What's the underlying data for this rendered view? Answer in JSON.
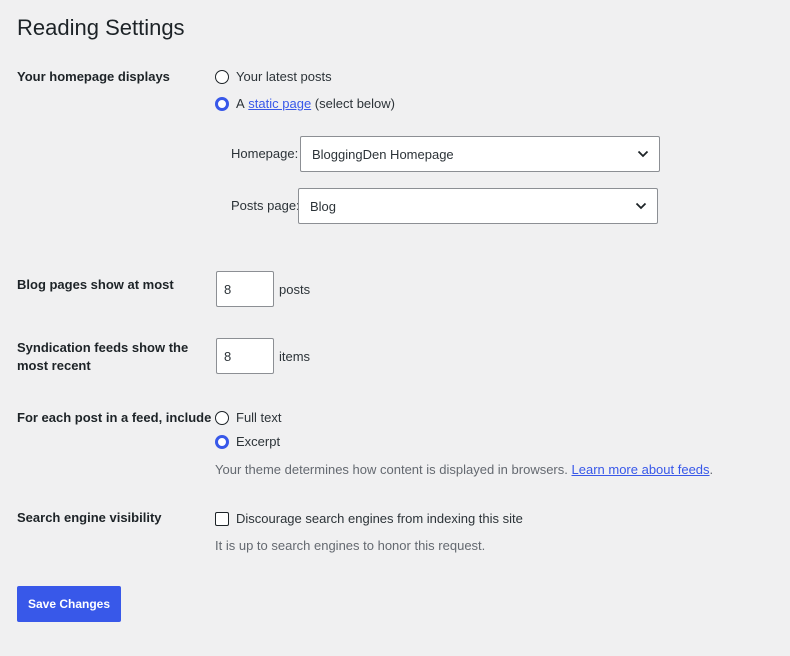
{
  "page": {
    "title": "Reading Settings"
  },
  "homepage_displays": {
    "label": "Your homepage displays",
    "option_latest": "Your latest posts",
    "option_static_prefix": "A",
    "option_static_link": "static page",
    "option_static_suffix": "(select below)",
    "selected": "static",
    "homepage_label": "Homepage:",
    "homepage_value": "BloggingDen Homepage",
    "posts_page_label": "Posts page:",
    "posts_page_value": "Blog"
  },
  "blog_pages": {
    "label": "Blog pages show at most",
    "value": "8",
    "suffix": "posts"
  },
  "syndication": {
    "label": "Syndication feeds show the most recent",
    "value": "8",
    "suffix": "items"
  },
  "feed_include": {
    "label": "For each post in a feed, include",
    "option_full": "Full text",
    "option_excerpt": "Excerpt",
    "selected": "excerpt",
    "description_prefix": "Your theme determines how content is displayed in browsers.",
    "description_link": "Learn more about feeds",
    "description_suffix": "."
  },
  "search_visibility": {
    "label": "Search engine visibility",
    "checkbox_label": "Discourage search engines from indexing this site",
    "checked": false,
    "description": "It is up to search engines to honor this request."
  },
  "actions": {
    "save_label": "Save Changes"
  },
  "colors": {
    "accent": "#3858e9",
    "background": "#f0f0f1",
    "text": "#1d2327",
    "muted": "#646970"
  }
}
